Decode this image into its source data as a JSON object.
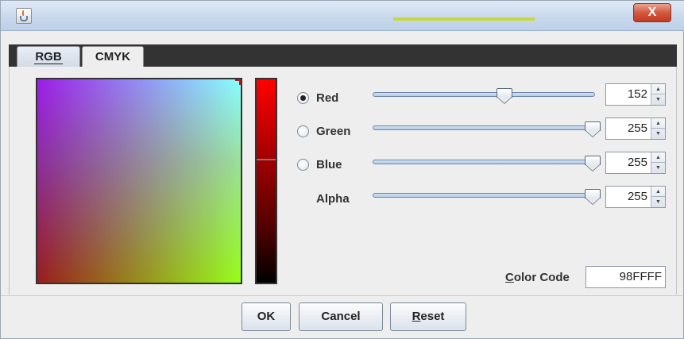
{
  "window": {
    "title": "",
    "close_label": "X"
  },
  "tabs": [
    {
      "label": "RGB",
      "mnemonic": "",
      "selected": true
    },
    {
      "label": "CMYK",
      "selected": false
    }
  ],
  "channels": [
    {
      "name": "Red",
      "value": "152",
      "selectable": true,
      "selected": true,
      "level": 0.6
    },
    {
      "name": "Green",
      "value": "255",
      "selectable": true,
      "selected": false,
      "level": 1.0
    },
    {
      "name": "Blue",
      "value": "255",
      "selectable": true,
      "selected": false,
      "level": 1.0
    },
    {
      "name": "Alpha",
      "value": "255",
      "selectable": false,
      "selected": false,
      "level": 1.0
    }
  ],
  "color_code": {
    "label": "Color Code",
    "label_rest": "olor Code",
    "label_first": "C",
    "value": "98FFFF"
  },
  "buttons": {
    "ok": "OK",
    "cancel": "Cancel",
    "reset_first": "R",
    "reset_rest": "eset"
  },
  "colors": {
    "tab_strip": "#333333",
    "close_button": "#d2593f",
    "accent": "#c6d83a"
  },
  "icons": {
    "app": "java-icon",
    "close": "close-icon"
  }
}
